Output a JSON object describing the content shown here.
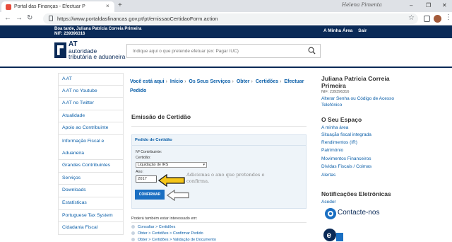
{
  "browser": {
    "tab_title": "Portal das Finanças - Efectuar P",
    "close_glyph": "×",
    "newtab_glyph": "+",
    "profile_name": "Helena Pimenta",
    "url": "https://www.portaldasfinancas.gov.pt/pt/emissaoCertidaoForm.action",
    "win_min": "–",
    "win_max": "❐",
    "win_close": "✕"
  },
  "topbar": {
    "greeting": "Boa tarde, Juliana Patricia Correia Primeira",
    "nif": "NIF: 239396316",
    "links": [
      "A Minha Área",
      "Sair"
    ]
  },
  "logo": {
    "at": "AT",
    "line1": "autoridade",
    "line2": "tributária e aduaneira"
  },
  "search": {
    "placeholder": "Indique aqui o que pretende efetuar (ex: Pagar IUC)",
    "icon": "search-icon"
  },
  "sidebar": {
    "items": [
      "A AT",
      "A AT no Youtube",
      "A AT no Twitter",
      "Atualidade",
      "Apoio ao Contribuinte",
      "Informação Fiscal e Aduaneira",
      "Grandes Contribuintes",
      "Serviços",
      "Downloads",
      "Estatísticas",
      "Portuguese Tax System",
      "Cidadania Fiscal"
    ]
  },
  "breadcrumb": {
    "prefix": "Você está aqui",
    "items": [
      "Início",
      "Os Seus Serviços",
      "Obter",
      "Certidões",
      "Efectuar Pedido"
    ]
  },
  "main": {
    "title": "Emissão de Certidão",
    "form": {
      "heading": "Pedido de Certidão",
      "nif_label": "Nº Contribuinte:",
      "cert_label": "Certidão:",
      "cert_value": "Liquidação de IRS",
      "year_label": "Ano:",
      "year_value": "2017",
      "confirm_label": "CONFIRMAR"
    },
    "annotation": "Adicionas o ano que pretendes e confirma.",
    "also_heading": "Poderá também estar interessado em:",
    "also_links": [
      "Consultar > Certidões",
      "Obter > Certidões > Confirmar Pedido",
      "Obter > Certidões > Validação de Documento"
    ]
  },
  "right": {
    "name": "Juliana Patricia Correia Primeira",
    "nif": "NIF: 239396316",
    "links1": [
      "Alterar Senha ou Código de Acesso",
      "Telefónico"
    ],
    "espaco_title": "O Seu Espaço",
    "espaco_links": [
      "A minha área",
      "Situação fiscal integrada",
      "Rendimentos (IR)",
      "Património",
      "Movimentos Financeiros",
      "Dívidas Fiscais / Coimas",
      "Alertas"
    ],
    "notif_title": "Notificações Eletrónicas",
    "notif_link": "Aceder",
    "contact": "Contacte-nos"
  },
  "colors": {
    "brand_navy": "#0a2a57",
    "link_blue": "#0a5ea8",
    "button_blue": "#1a6fc2",
    "annotation_arrow": "#f5c518"
  }
}
